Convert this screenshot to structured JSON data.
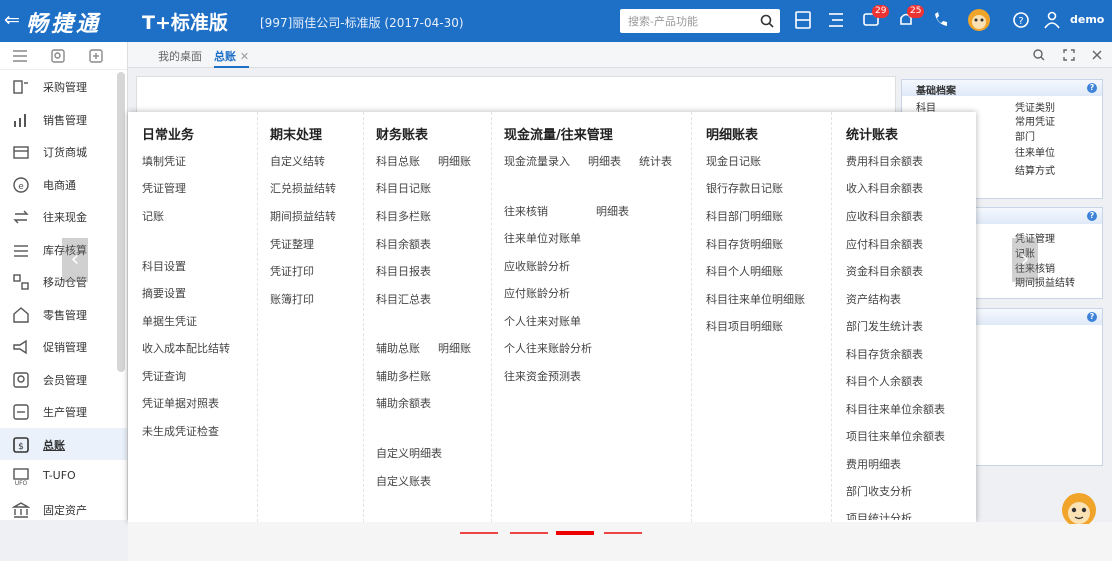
{
  "header": {
    "brand": "畅捷通",
    "product": "T+标准版",
    "company": "[997]丽佳公司-标准版 (2017-04-30)",
    "search_placeholder": "搜索-产品功能",
    "badge_a": "29",
    "badge_b": "25",
    "user": "demo"
  },
  "sidebar": {
    "items": [
      {
        "label": "采购管理",
        "icon": "purchase-icon"
      },
      {
        "label": "销售管理",
        "icon": "sales-icon"
      },
      {
        "label": "订货商城",
        "icon": "store-icon"
      },
      {
        "label": "电商通",
        "icon": "ecommerce-icon"
      },
      {
        "label": "往来现金",
        "icon": "cash-icon"
      },
      {
        "label": "库存核算",
        "icon": "inventory-icon"
      },
      {
        "label": "移动仓管",
        "icon": "mobile-warehouse-icon"
      },
      {
        "label": "零售管理",
        "icon": "retail-icon"
      },
      {
        "label": "促销管理",
        "icon": "promotion-icon"
      },
      {
        "label": "会员管理",
        "icon": "member-icon"
      },
      {
        "label": "生产管理",
        "icon": "production-icon"
      },
      {
        "label": "总账",
        "icon": "ledger-icon"
      },
      {
        "label": "T-UFO",
        "icon": "ufo-icon"
      },
      {
        "label": "固定资产",
        "icon": "asset-icon"
      }
    ]
  },
  "tabs": [
    {
      "label": "我的桌面"
    },
    {
      "label": "总账"
    }
  ],
  "right_panel": {
    "card1_title": "基础档案",
    "card1_left": [
      "科目"
    ],
    "card1_right": [
      "凭证类别",
      "常用凭证",
      "部门",
      "往来单位",
      "结算方式"
    ],
    "card2_items": [
      "凭证管理",
      "记账",
      "往来核销",
      "期间损益结转"
    ]
  },
  "mega": {
    "columns": [
      {
        "title": "日常业务",
        "items": [
          "填制凭证",
          "凭证管理",
          "记账",
          "科目设置",
          "摘要设置",
          "单据生凭证",
          "收入成本配比结转",
          "凭证查询",
          "凭证单据对照表",
          "未生成凭证检查"
        ]
      },
      {
        "title": "期末处理",
        "items": [
          "自定义结转",
          "汇兑损益结转",
          "期间损益结转",
          "凭证整理",
          "凭证打印",
          "账簿打印"
        ]
      },
      {
        "title": "财务账表",
        "items": [
          "科目总账",
          "明细账",
          "科目日记账",
          "科目多栏账",
          "科目余额表",
          "科目日报表",
          "科目汇总表",
          "辅助总账",
          "明细账",
          "辅助多栏账",
          "辅助余额表",
          "自定义明细表",
          "自定义账表"
        ]
      },
      {
        "title": "现金流量/往来管理",
        "items": [
          "现金流量录入",
          "明细表",
          "统计表",
          "往来核销",
          "明细表",
          "往来单位对账单",
          "应收账龄分析",
          "应付账龄分析",
          "个人往来对账单",
          "个人往来账龄分析",
          "往来资金预测表"
        ]
      },
      {
        "title": "明细账表",
        "items": [
          "现金日记账",
          "银行存款日记账",
          "科目部门明细账",
          "科目存货明细账",
          "科目个人明细账",
          "科目往来单位明细账",
          "科目项目明细账"
        ]
      },
      {
        "title": "统计账表",
        "items": [
          "费用科目余额表",
          "收入科目余额表",
          "应收科目余额表",
          "应付科目余额表",
          "资金科目余额表",
          "资产结构表",
          "部门发生统计表",
          "科目存货余额表",
          "科目个人余额表",
          "科目往来单位余额表",
          "项目往来单位余额表",
          "费用明细表",
          "部门收支分析",
          "项目统计分析"
        ]
      }
    ]
  }
}
